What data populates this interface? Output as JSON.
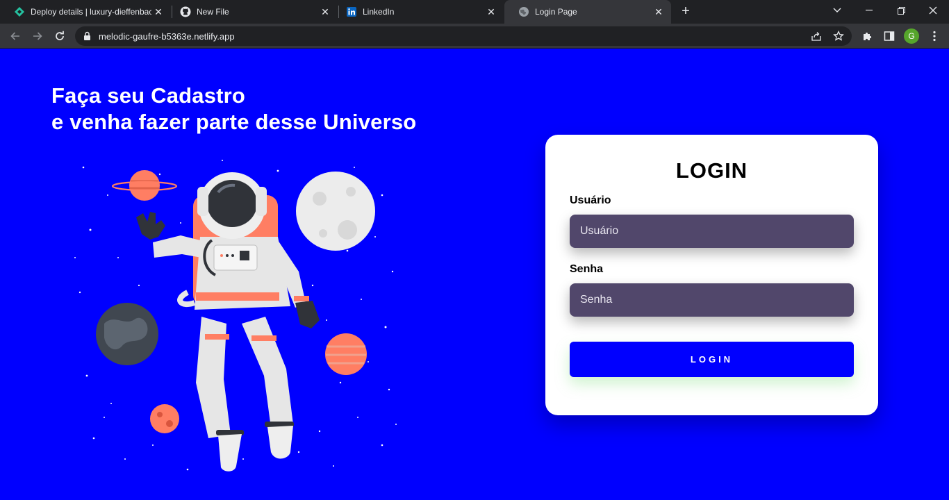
{
  "browser": {
    "tabs": [
      {
        "title": "Deploy details | luxury-dieffenbac",
        "icon": "netlify-icon"
      },
      {
        "title": "New File",
        "icon": "github-icon"
      },
      {
        "title": "LinkedIn",
        "icon": "linkedin-icon"
      },
      {
        "title": "Login Page",
        "icon": "globe-icon",
        "active": true
      }
    ],
    "url": "melodic-gaufre-b5363e.netlify.app",
    "profile_initial": "G"
  },
  "page": {
    "heading_line1": "Faça seu Cadastro",
    "heading_line2": "e venha fazer parte desse Universo",
    "login": {
      "title": "LOGIN",
      "user_label": "Usuário",
      "user_placeholder": "Usuário",
      "pass_label": "Senha",
      "pass_placeholder": "Senha",
      "button_label": "LOGIN"
    }
  },
  "colors": {
    "page_background": "#0000ff",
    "input_background": "#51476b",
    "button_background": "#0000ff"
  }
}
